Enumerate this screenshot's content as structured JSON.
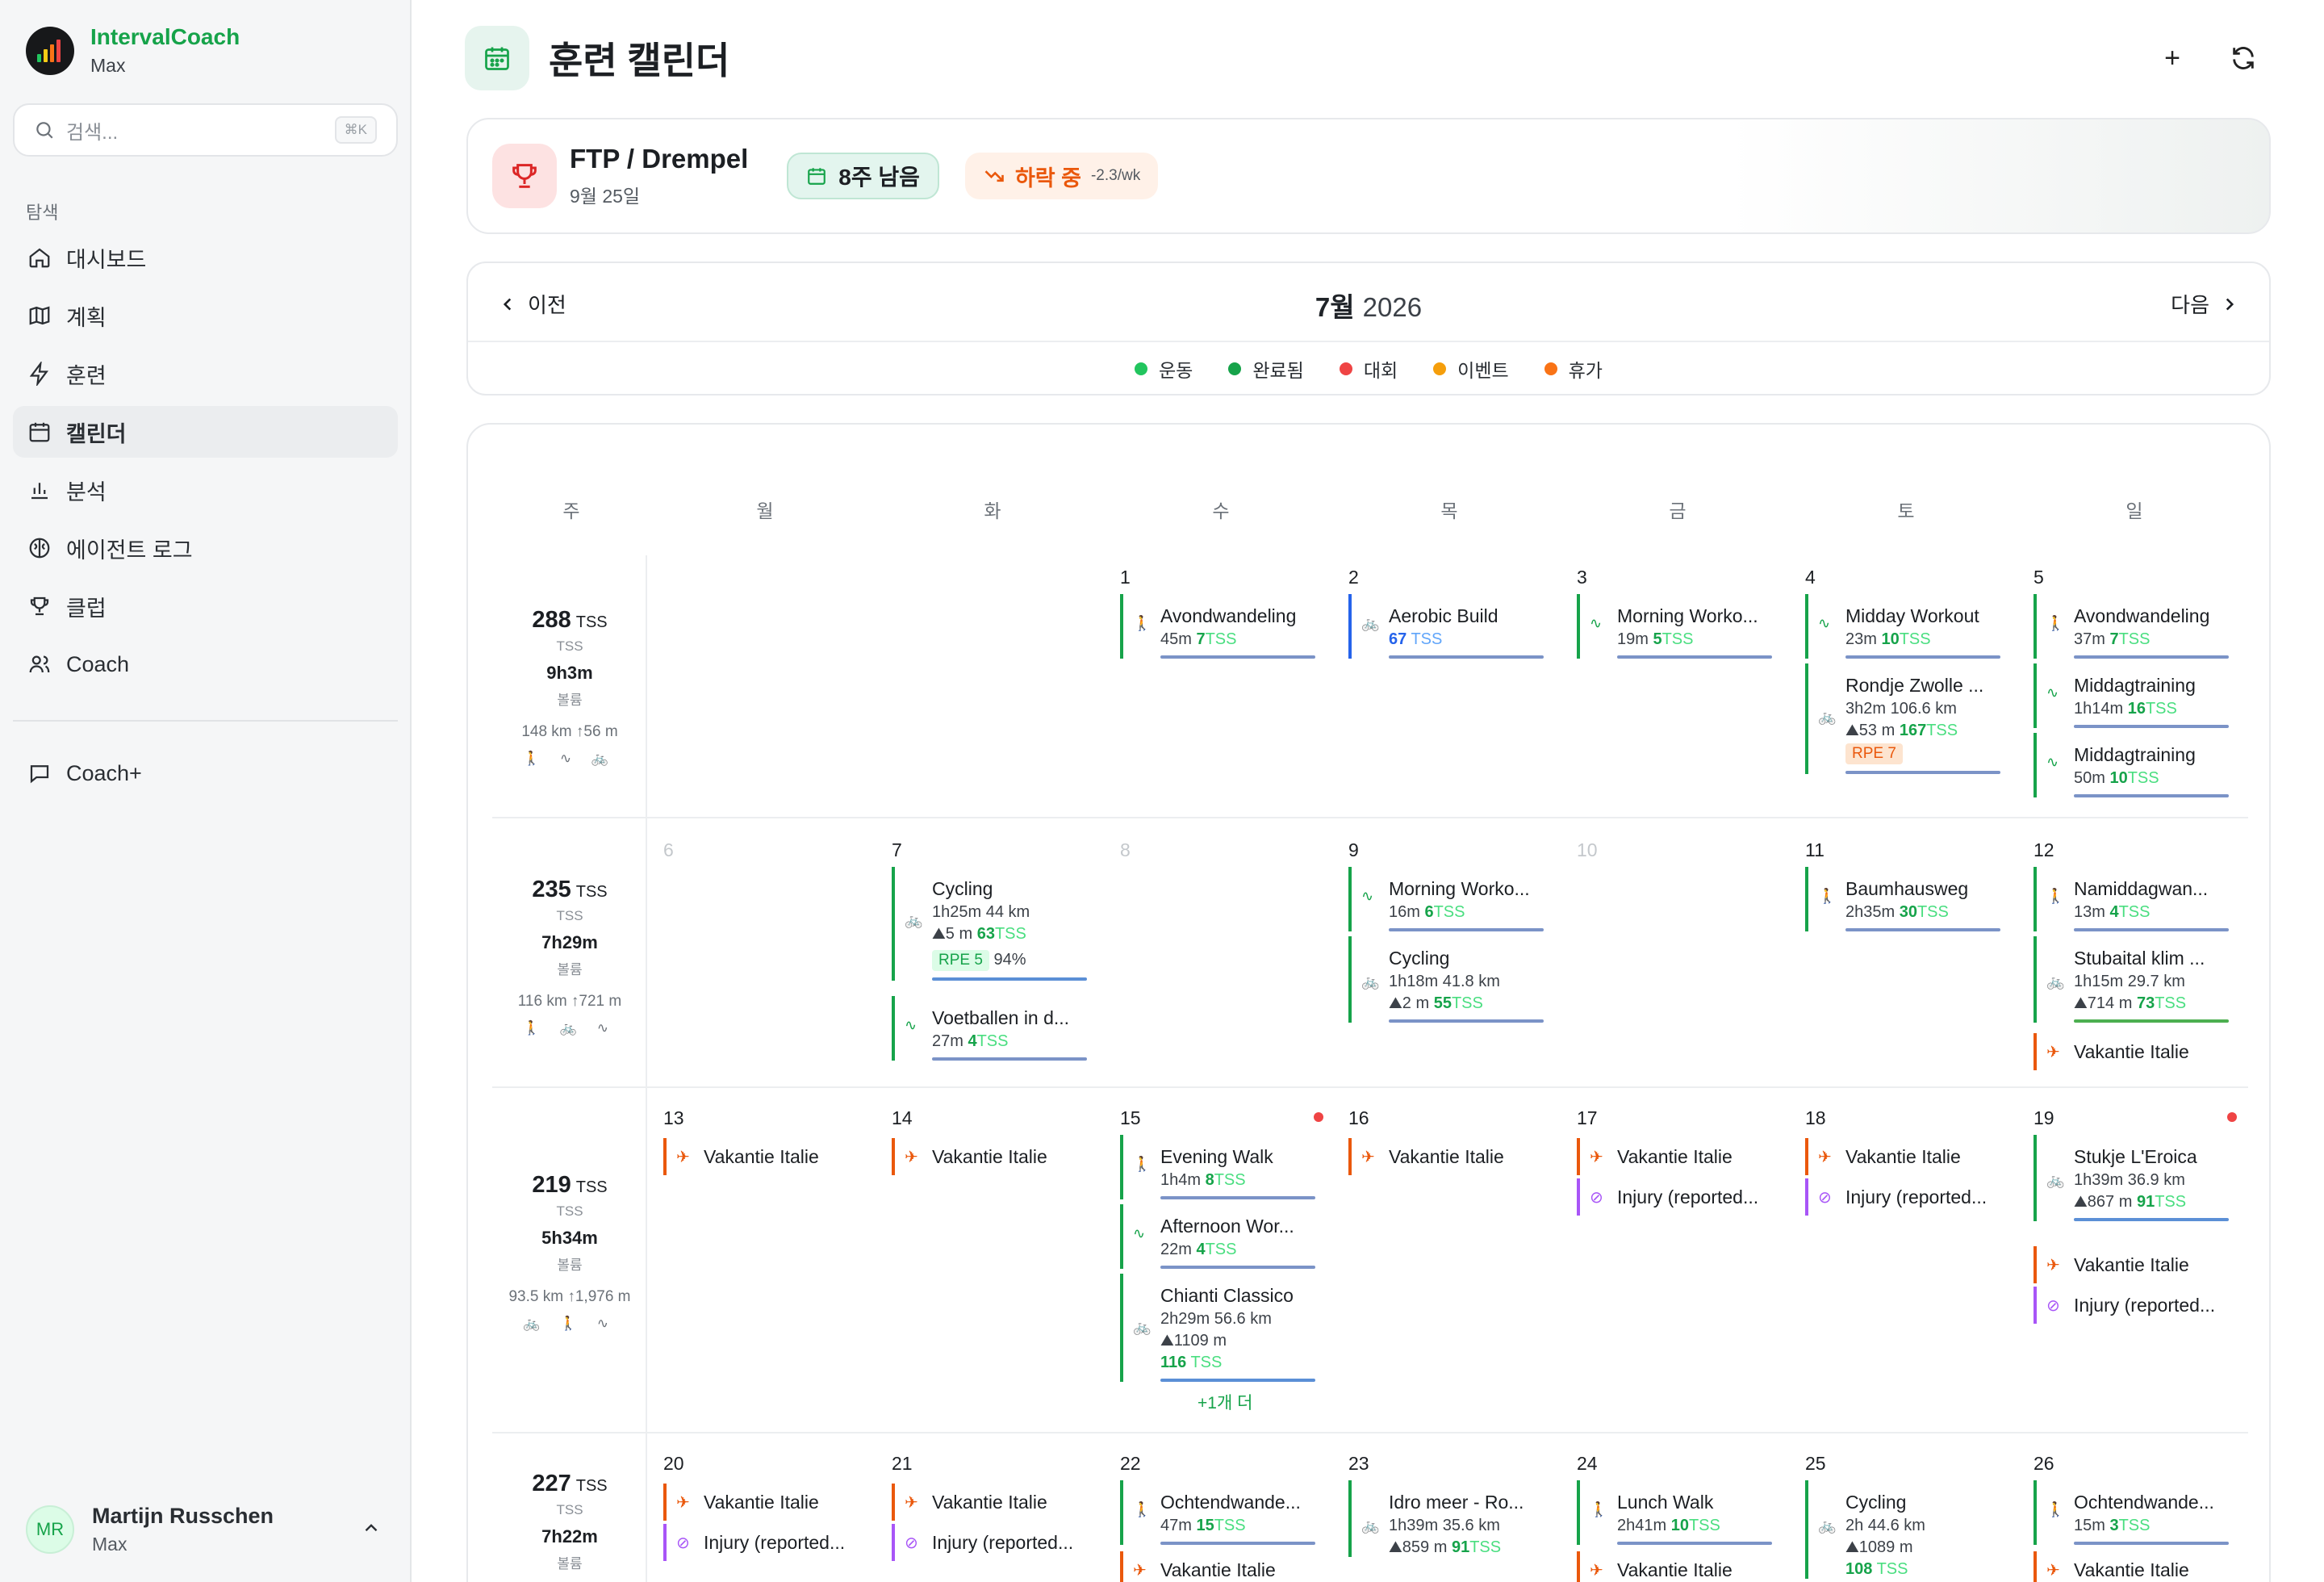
{
  "app": {
    "brand": "IntervalCoach",
    "brand_sub": "Max"
  },
  "search": {
    "placeholder": "검색...",
    "shortcut": "⌘K"
  },
  "nav": {
    "heading": "탐색",
    "items": [
      {
        "label": "대시보드",
        "icon": "home-icon"
      },
      {
        "label": "계획",
        "icon": "map-icon"
      },
      {
        "label": "훈련",
        "icon": "bolt-icon"
      },
      {
        "label": "캘린더",
        "icon": "calendar-icon",
        "active": true
      },
      {
        "label": "분석",
        "icon": "bar-chart-icon"
      },
      {
        "label": "에이전트 로그",
        "icon": "brain-icon"
      },
      {
        "label": "클럽",
        "icon": "trophy-icon"
      },
      {
        "label": "Coach",
        "icon": "users-icon"
      }
    ],
    "coachplus": "Coach+"
  },
  "user": {
    "initials": "MR",
    "name": "Martijn Russchen",
    "sub": "Max"
  },
  "page": {
    "title": "훈련 캘린더",
    "add": "+",
    "refresh": "⟳"
  },
  "goal": {
    "title": "FTP / Drempel",
    "date": "9월 25일",
    "weeks_left": "8주 남음",
    "trend": "하락 중",
    "trend_rate": "-2.3/wk"
  },
  "month": {
    "prev": "이전",
    "next": "다음",
    "month": "7월",
    "year": "2026"
  },
  "legend": [
    {
      "label": "운동",
      "color": "#22c55e"
    },
    {
      "label": "완료됨",
      "color": "#16a34a"
    },
    {
      "label": "대회",
      "color": "#ef4444"
    },
    {
      "label": "이벤트",
      "color": "#f59e0b"
    },
    {
      "label": "휴가",
      "color": "#f97316"
    }
  ],
  "day_headers": [
    "주",
    "월",
    "화",
    "수",
    "목",
    "금",
    "토",
    "일"
  ],
  "weeks": [
    {
      "tss": "288",
      "tss_unit": "TSS",
      "tss_lbl": "TSS",
      "dur": "9h3m",
      "dur_lbl": "볼륨",
      "dist": "148 km  ↑56 m",
      "icons": "🚶 ∿ 🚲",
      "days": [
        "",
        "",
        "1",
        "2",
        "3",
        "4",
        "5"
      ]
    },
    {
      "tss": "235",
      "tss_unit": "TSS",
      "tss_lbl": "TSS",
      "dur": "7h29m",
      "dur_lbl": "볼륨",
      "dist": "116 km  ↑721 m",
      "icons": "🚶 🚲 ∿",
      "days": [
        "6",
        "7",
        "8",
        "9",
        "10",
        "11",
        "12"
      ]
    },
    {
      "tss": "219",
      "tss_unit": "TSS",
      "tss_lbl": "TSS",
      "dur": "5h34m",
      "dur_lbl": "볼륨",
      "dist": "93.5 km  ↑1,976 m",
      "icons": "🚲 🚶 ∿",
      "days": [
        "13",
        "14",
        "15",
        "16",
        "17",
        "18",
        "19"
      ]
    },
    {
      "tss": "227",
      "tss_unit": "TSS",
      "tss_lbl": "TSS",
      "dur": "7h22m",
      "dur_lbl": "볼륨",
      "dist": "",
      "icons": "",
      "days": [
        "20",
        "21",
        "22",
        "23",
        "24",
        "25",
        "26"
      ]
    }
  ],
  "activities": {
    "w1": [
      {
        "name": "Avondwandeling",
        "meta": "45m",
        "tss": "7",
        "unit": "TSS",
        "icon": "walk-icon"
      },
      {
        "name": "Aerobic Build",
        "meta": "",
        "tss": "67",
        "unit": "TSS",
        "icon": "bike-icon"
      },
      {
        "name": "Morning Worko...",
        "meta": "19m",
        "tss": "5",
        "unit": "TSS",
        "icon": "pulse-icon"
      },
      {
        "name": "Midday Workout",
        "meta": "23m",
        "tss": "10",
        "unit": "TSS",
        "icon": "pulse-icon"
      },
      {
        "name": "Rondje Zwolle ...",
        "meta": "3h2m  106.6 km",
        "meta2": "⛰53 m",
        "tss": "167",
        "unit": "TSS",
        "rpe": "RPE 7",
        "icon": "bike-icon"
      },
      {
        "name": "Avondwandeling",
        "meta": "37m",
        "tss": "7",
        "unit": "TSS",
        "icon": "walk-icon"
      },
      {
        "name": "Middagtraining",
        "meta": "1h14m",
        "tss": "16",
        "unit": "TSS",
        "icon": "pulse-icon"
      },
      {
        "name": "Middagtraining",
        "meta": "50m",
        "tss": "10",
        "unit": "TSS",
        "icon": "pulse-icon"
      }
    ],
    "w2": [
      {
        "name": "Cycling",
        "meta": "1h25m  44 km",
        "meta2": "⛰5 m",
        "tss": "63",
        "unit": "TSS",
        "rpe": "RPE 5",
        "rpe_extra": "94%",
        "icon": "bike-icon"
      },
      {
        "name": "Voetballen in d...",
        "meta": "27m",
        "tss": "4",
        "unit": "TSS",
        "icon": "pulse-icon"
      },
      {
        "name": "Morning Worko...",
        "meta": "16m",
        "tss": "6",
        "unit": "TSS",
        "icon": "pulse-icon"
      },
      {
        "name": "Cycling",
        "meta": "1h18m  41.8 km",
        "meta2": "⛰2 m",
        "tss": "55",
        "unit": "TSS",
        "icon": "bike-icon"
      },
      {
        "name": "Baumhausweg",
        "meta": "2h35m",
        "tss": "30",
        "unit": "TSS",
        "icon": "walk-icon"
      },
      {
        "name": "Namiddagwan...",
        "meta": "13m",
        "tss": "4",
        "unit": "TSS",
        "icon": "walk-icon"
      },
      {
        "name": "Stubaital klim ...",
        "meta": "1h15m  29.7 km",
        "meta2": "⛰714 m",
        "tss": "73",
        "unit": "TSS",
        "icon": "bike-icon"
      },
      {
        "name": "Vakantie Italie",
        "icon": "plane-icon"
      }
    ],
    "w3": [
      {
        "name": "Vakantie Italie",
        "icon": "plane-icon"
      },
      {
        "name": "Vakantie Italie",
        "icon": "plane-icon"
      },
      {
        "name": "Evening Walk",
        "meta": "1h4m",
        "tss": "8",
        "unit": "TSS",
        "icon": "walk-icon"
      },
      {
        "name": "Afternoon Wor...",
        "meta": "22m",
        "tss": "4",
        "unit": "TSS",
        "icon": "pulse-icon"
      },
      {
        "name": "Chianti Classico",
        "meta": "2h29m  56.6 km",
        "meta2": "⛰1109 m",
        "tss": "116",
        "unit": "TSS",
        "icon": "bike-icon"
      },
      {
        "more": "+1개 더"
      },
      {
        "name": "Vakantie Italie",
        "icon": "plane-icon"
      },
      {
        "name": "Vakantie Italie",
        "icon": "plane-icon"
      },
      {
        "name": "Injury (reported...",
        "icon": "ban-icon"
      },
      {
        "name": "Vakantie Italie",
        "icon": "plane-icon"
      },
      {
        "name": "Injury (reported...",
        "icon": "ban-icon"
      },
      {
        "name": "Stukje L'Eroica",
        "meta": "1h39m  36.9 km",
        "meta2": "⛰867 m",
        "tss": "91",
        "unit": "TSS",
        "icon": "bike-icon"
      },
      {
        "name": "Vakantie Italie",
        "icon": "plane-icon"
      },
      {
        "name": "Injury (reported...",
        "icon": "ban-icon"
      }
    ],
    "w4": [
      {
        "name": "Vakantie Italie",
        "icon": "plane-icon"
      },
      {
        "name": "Injury (reported...",
        "icon": "ban-icon"
      },
      {
        "name": "Vakantie Italie",
        "icon": "plane-icon"
      },
      {
        "name": "Injury (reported...",
        "icon": "ban-icon"
      },
      {
        "name": "Ochtendwande...",
        "meta": "47m",
        "tss": "15",
        "unit": "TSS",
        "icon": "walk-icon"
      },
      {
        "name": "Vakantie Italie",
        "icon": "plane-icon"
      },
      {
        "name": "Idro meer - Ro...",
        "meta": "1h39m  35.6 km",
        "meta2": "⛰859 m",
        "tss": "91",
        "unit": "TSS",
        "icon": "bike-icon"
      },
      {
        "name": "Lunch Walk",
        "meta": "2h41m",
        "tss": "10",
        "unit": "TSS",
        "icon": "walk-icon"
      },
      {
        "name": "Vakantie Italie",
        "icon": "plane-icon"
      },
      {
        "name": "Cycling",
        "meta": "2h  44.6 km",
        "meta2": "⛰1089 m",
        "tss": "108",
        "unit": "TSS",
        "icon": "bike-icon"
      },
      {
        "name": "Ochtendwande...",
        "meta": "15m",
        "tss": "3",
        "unit": "TSS",
        "icon": "walk-icon"
      },
      {
        "name": "Vakantie Italie",
        "icon": "plane-icon"
      }
    ]
  }
}
